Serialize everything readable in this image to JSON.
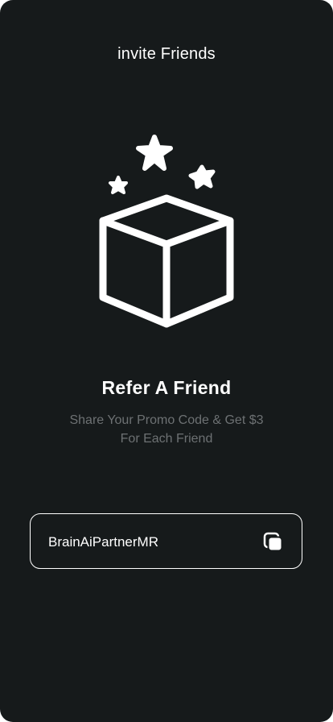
{
  "header": {
    "title": "invite Friends"
  },
  "illustration": {
    "icon": "gift-box-with-stars-icon"
  },
  "content": {
    "headline": "Refer A Friend",
    "subtext_line1": "Share Your Promo Code & Get $3",
    "subtext_line2": "For Each Friend"
  },
  "promo": {
    "code": "BrainAiPartnerMR",
    "copy_icon": "copy-icon"
  },
  "colors": {
    "background": "#161a1b",
    "text_primary": "#ffffff",
    "text_secondary": "#6d7173"
  }
}
